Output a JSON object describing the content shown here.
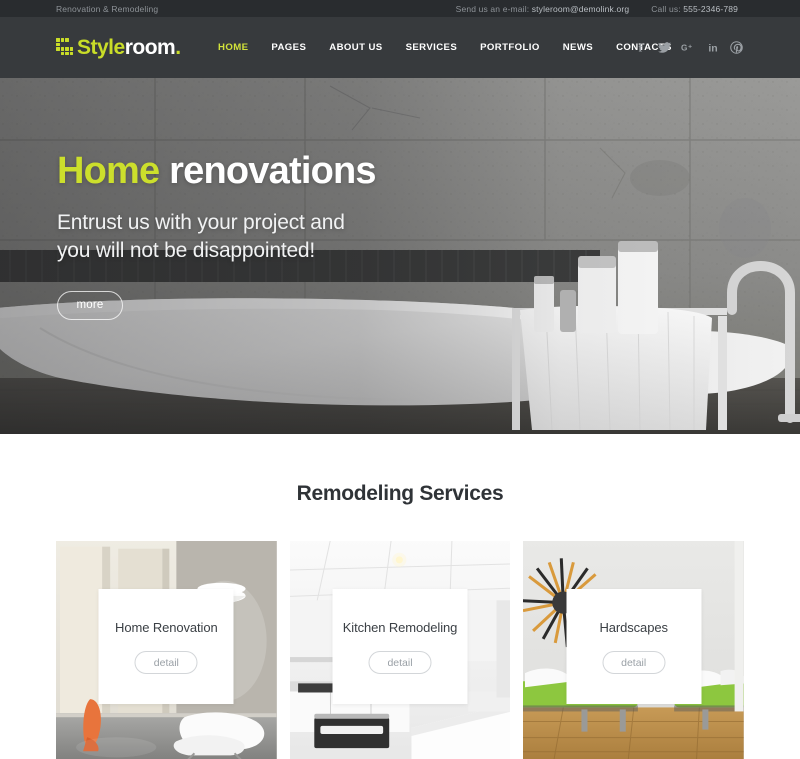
{
  "topbar": {
    "tagline": "Renovation & Remodeling",
    "email_label": "Send us an e-mail:",
    "email_value": "styleroom@demolink.org",
    "phone_label": "Call us:",
    "phone_value": "555-2346-789"
  },
  "header": {
    "logo": {
      "part1": "Style",
      "part2": "room",
      "part3": "."
    },
    "nav": [
      {
        "label": "HOME",
        "active": true
      },
      {
        "label": "PAGES",
        "active": false
      },
      {
        "label": "ABOUT US",
        "active": false
      },
      {
        "label": "SERVICES",
        "active": false
      },
      {
        "label": "PORTFOLIO",
        "active": false
      },
      {
        "label": "NEWS",
        "active": false
      },
      {
        "label": "CONTACTS",
        "active": false
      }
    ],
    "socials": [
      {
        "name": "facebook-icon",
        "glyph": "f"
      },
      {
        "name": "twitter-icon",
        "glyph": "t"
      },
      {
        "name": "google-plus-icon",
        "glyph": "G+"
      },
      {
        "name": "linkedin-icon",
        "glyph": "in"
      },
      {
        "name": "pinterest-icon",
        "glyph": "P"
      }
    ]
  },
  "hero": {
    "title_accent": "Home",
    "title_rest": "renovations",
    "subtitle_line1": "Entrust us with your project and",
    "subtitle_line2": "you will not be disappointed!",
    "button_label": "more",
    "image_alt": "modern bathroom with freestanding bathtub, towel rack and concrete wall"
  },
  "services": {
    "heading": "Remodeling Services",
    "cards": [
      {
        "title": "Home Renovation",
        "button_label": "detail",
        "image_alt": "bright interior with wall panels and white lounge chair"
      },
      {
        "title": "Kitchen Remodeling",
        "button_label": "detail",
        "image_alt": "white modern kitchen with cooktop and cabinets"
      },
      {
        "title": "Hardscapes",
        "button_label": "detail",
        "image_alt": "room with sun wall decor, green bench and wood floor"
      }
    ]
  },
  "colors": {
    "accent": "#c9dd28",
    "topbar_bg": "#292c2f",
    "header_bg": "#373a3d",
    "nav_active": "#d2e23a",
    "heading": "#2f3337"
  }
}
